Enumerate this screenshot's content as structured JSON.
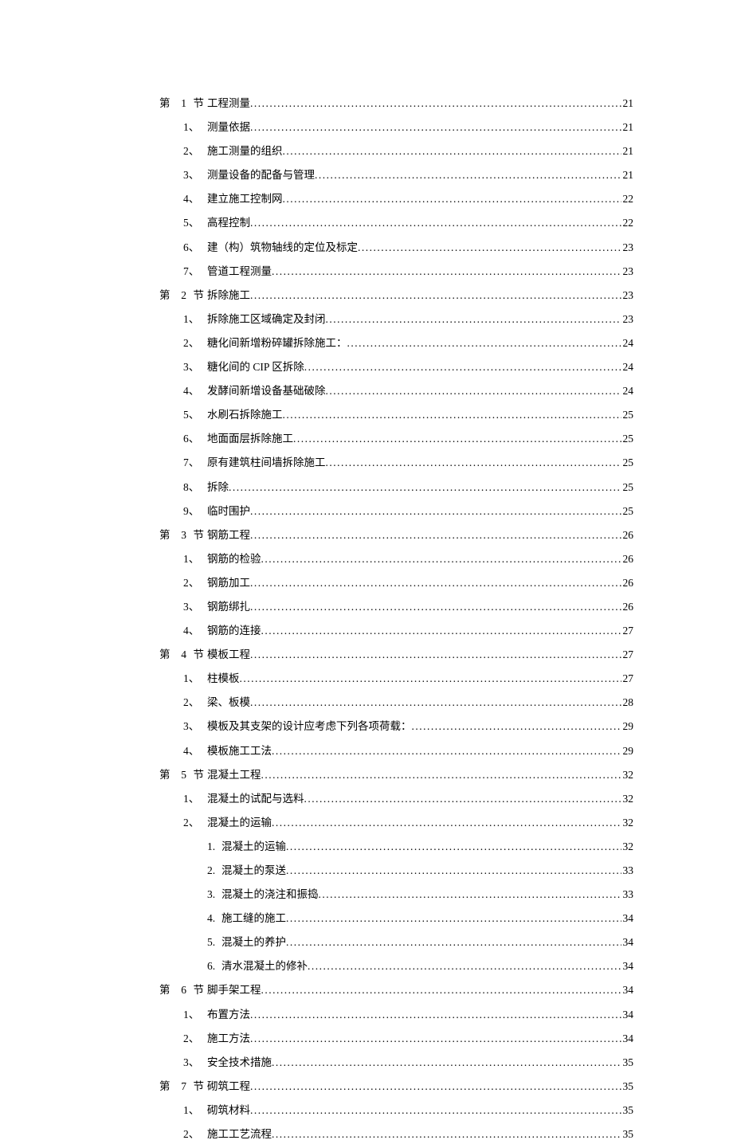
{
  "toc": [
    {
      "level": 0,
      "label": "第 1 节",
      "title": "工程测量",
      "page": "21"
    },
    {
      "level": 1,
      "label": "1、",
      "title": "测量依据",
      "page": "21"
    },
    {
      "level": 1,
      "label": "2、",
      "title": "施工测量的组织",
      "page": "21"
    },
    {
      "level": 1,
      "label": "3、",
      "title": "测量设备的配备与管理",
      "page": "21"
    },
    {
      "level": 1,
      "label": "4、",
      "title": "建立施工控制网",
      "page": "22"
    },
    {
      "level": 1,
      "label": "5、",
      "title": "高程控制",
      "page": "22"
    },
    {
      "level": 1,
      "label": "6、",
      "title": "建（构）筑物轴线的定位及标定",
      "page": "23"
    },
    {
      "level": 1,
      "label": "7、",
      "title": "管道工程测量",
      "page": "23"
    },
    {
      "level": 0,
      "label": "第 2 节",
      "title": "拆除施工",
      "page": "23"
    },
    {
      "level": 1,
      "label": "1、",
      "title": "拆除施工区域确定及封闭",
      "page": "23"
    },
    {
      "level": 1,
      "label": "2、",
      "title": "糖化间新增粉碎罐拆除施工：",
      "page": "24"
    },
    {
      "level": 1,
      "label": "3、",
      "title": "糖化间的 CIP 区拆除 ",
      "page": "24"
    },
    {
      "level": 1,
      "label": "4、",
      "title": "发酵间新增设备基础破除",
      "page": "24"
    },
    {
      "level": 1,
      "label": "5、",
      "title": "水刷石拆除施工",
      "page": "25"
    },
    {
      "level": 1,
      "label": "6、",
      "title": "地面面层拆除施工",
      "page": "25"
    },
    {
      "level": 1,
      "label": "7、",
      "title": "原有建筑柱间墙拆除施工",
      "page": "25"
    },
    {
      "level": 1,
      "label": "8、",
      "title": "拆除",
      "page": "25"
    },
    {
      "level": 1,
      "label": "9、",
      "title": "临时围护",
      "page": "25"
    },
    {
      "level": 0,
      "label": "第 3 节",
      "title": "钢筋工程",
      "page": "26"
    },
    {
      "level": 1,
      "label": "1、",
      "title": "钢筋的检验",
      "page": "26"
    },
    {
      "level": 1,
      "label": "2、",
      "title": "钢筋加工",
      "page": "26"
    },
    {
      "level": 1,
      "label": "3、",
      "title": "钢筋绑扎",
      "page": "26"
    },
    {
      "level": 1,
      "label": "4、",
      "title": "钢筋的连接",
      "page": "27"
    },
    {
      "level": 0,
      "label": "第 4 节",
      "title": "模板工程",
      "page": "27"
    },
    {
      "level": 1,
      "label": "1、",
      "title": "柱模板",
      "page": "27"
    },
    {
      "level": 1,
      "label": "2、",
      "title": "梁、板模",
      "page": "28"
    },
    {
      "level": 1,
      "label": "3、",
      "title": "模板及其支架的设计应考虑下列各项荷载：",
      "page": "29"
    },
    {
      "level": 1,
      "label": "4、",
      "title": "模板施工工法",
      "page": "29"
    },
    {
      "level": 0,
      "label": "第 5 节",
      "title": "混凝土工程",
      "page": "32"
    },
    {
      "level": 1,
      "label": "1、",
      "title": "混凝土的试配与选料",
      "page": "32"
    },
    {
      "level": 1,
      "label": "2、",
      "title": "混凝土的运输",
      "page": "32"
    },
    {
      "level": 2,
      "label": "1.",
      "title": "混凝土的运输",
      "page": "32"
    },
    {
      "level": 2,
      "label": "2.",
      "title": "混凝土的泵送",
      "page": "33"
    },
    {
      "level": 2,
      "label": "3.",
      "title": "混凝土的浇注和振捣",
      "page": "33"
    },
    {
      "level": 2,
      "label": "4.",
      "title": "施工缝的施工",
      "page": "34"
    },
    {
      "level": 2,
      "label": "5.",
      "title": "混凝土的养护",
      "page": "34"
    },
    {
      "level": 2,
      "label": "6.",
      "title": "清水混凝土的修补",
      "page": "34"
    },
    {
      "level": 0,
      "label": "第 6 节",
      "title": "脚手架工程",
      "page": "34"
    },
    {
      "level": 1,
      "label": "1、",
      "title": "布置方法",
      "page": "34"
    },
    {
      "level": 1,
      "label": "2、",
      "title": "施工方法",
      "page": "34"
    },
    {
      "level": 1,
      "label": "3、",
      "title": "安全技术措施",
      "page": "35"
    },
    {
      "level": 0,
      "label": "第 7 节",
      "title": "砌筑工程",
      "page": "35"
    },
    {
      "level": 1,
      "label": "1、",
      "title": "砌筑材料",
      "page": "35"
    },
    {
      "level": 1,
      "label": "2、",
      "title": "施工工艺流程",
      "page": "35"
    }
  ]
}
